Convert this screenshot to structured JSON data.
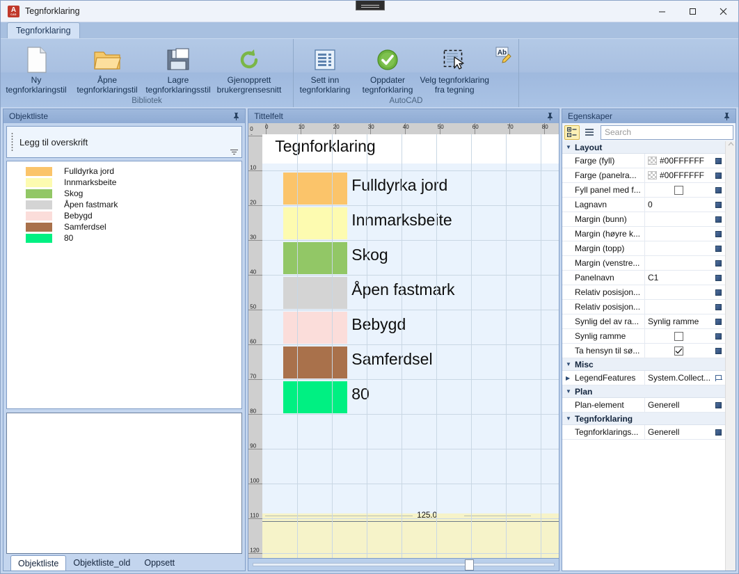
{
  "window": {
    "title": "Tegnforklaring",
    "logo_text": "A",
    "logo_sub": "CAD",
    "minimize": "minimize-icon",
    "maximize": "maximize-icon",
    "close": "close-icon"
  },
  "ribbon": {
    "tabs": [
      {
        "label": "Tegnforklaring",
        "active": true
      }
    ],
    "groups": [
      {
        "name": "Bibliotek",
        "buttons": [
          {
            "label": "Ny\ntegnforklaringstil",
            "icon": "new-document-icon"
          },
          {
            "label": "Åpne\ntegnforklaringstil",
            "icon": "open-folder-icon"
          },
          {
            "label": "Lagre\ntegnforklaringsstil",
            "icon": "save-floppy-icon"
          },
          {
            "label": "Gjenopprett\nbrukergrensesnitt",
            "icon": "restore-refresh-icon"
          }
        ]
      },
      {
        "name": "AutoCAD",
        "buttons": [
          {
            "label": "Sett inn\ntegnforklaring",
            "icon": "insert-legend-icon"
          },
          {
            "label": "Oppdater\ntegnforklaring",
            "icon": "green-check-icon"
          },
          {
            "label": "Velg tegnforklaring\nfra tegning",
            "icon": "select-from-drawing-icon"
          },
          {
            "label": "",
            "icon": "ab-edit-text-icon"
          }
        ]
      }
    ]
  },
  "left_panel": {
    "title": "Objektliste",
    "pin": "pin-icon",
    "header_dropzone": "Legg til overskrift",
    "items": [
      {
        "label": "Fulldyrka jord",
        "color": "#FBC46A"
      },
      {
        "label": "Innmarksbeite",
        "color": "#FDFBB0"
      },
      {
        "label": "Skog",
        "color": "#92C766"
      },
      {
        "label": "Åpen fastmark",
        "color": "#D4D4D4"
      },
      {
        "label": "Bebygd",
        "color": "#FBDDDA"
      },
      {
        "label": "Samferdsel",
        "color": "#A9714B"
      },
      {
        "label": "80",
        "color": "#00F082"
      }
    ],
    "tabs": [
      {
        "label": "Objektliste",
        "active": true
      },
      {
        "label": "Objektliste_old",
        "active": false
      },
      {
        "label": "Oppsett",
        "active": false
      }
    ]
  },
  "center_panel": {
    "title": "Tittelfelt",
    "pin": "pin-icon",
    "ruler": {
      "corner_label": "0",
      "h_ticks": [
        0,
        10,
        20,
        30,
        40,
        50,
        60,
        70,
        80
      ],
      "v_ticks": [
        0,
        10,
        20,
        30,
        40,
        50,
        60,
        70,
        80,
        90,
        100,
        110,
        120
      ]
    },
    "legend": {
      "title": "Tegnforklaring",
      "entries": [
        {
          "label": "Fulldyrka jord",
          "color": "#FBC46A"
        },
        {
          "label": "Innmarksbeite",
          "color": "#FDFBB0"
        },
        {
          "label": "Skog",
          "color": "#92C766"
        },
        {
          "label": "Åpen fastmark",
          "color": "#D4D4D4"
        },
        {
          "label": "Bebygd",
          "color": "#FBDDDA"
        },
        {
          "label": "Samferdsel",
          "color": "#A9714B"
        },
        {
          "label": "80",
          "color": "#00F082"
        }
      ]
    },
    "dimension_label": "125.0"
  },
  "right_panel": {
    "title": "Egenskaper",
    "pin": "pin-icon",
    "toolbar": {
      "categorized": "categorized-view-icon",
      "alphabetical": "alphabetical-view-icon",
      "search_placeholder": "Search",
      "search_value": ""
    },
    "categories": [
      {
        "name": "Layout",
        "expanded": true,
        "rows": [
          {
            "name": "Farge (fyll)",
            "value": "#00FFFFFF",
            "kind": "color"
          },
          {
            "name": "Farge (panelra...",
            "value": "#00FFFFFF",
            "kind": "color"
          },
          {
            "name": "Fyll panel med f...",
            "value": "",
            "kind": "checkbox",
            "checked": false
          },
          {
            "name": "Lagnavn",
            "value": "0",
            "kind": "text"
          },
          {
            "name": "Margin (bunn)",
            "value": "",
            "kind": "text"
          },
          {
            "name": "Margin (høyre k...",
            "value": "",
            "kind": "text"
          },
          {
            "name": "Margin (topp)",
            "value": "",
            "kind": "text"
          },
          {
            "name": "Margin (venstre...",
            "value": "",
            "kind": "text"
          },
          {
            "name": "Panelnavn",
            "value": "C1",
            "kind": "text"
          },
          {
            "name": "Relativ posisjon...",
            "value": "",
            "kind": "text"
          },
          {
            "name": "Relativ posisjon...",
            "value": "",
            "kind": "text"
          },
          {
            "name": "Synlig del av ra...",
            "value": "Synlig ramme",
            "kind": "text"
          },
          {
            "name": "Synlig ramme",
            "value": "",
            "kind": "checkbox",
            "checked": false
          },
          {
            "name": "Ta hensyn til sø...",
            "value": "",
            "kind": "checkbox",
            "checked": true
          }
        ]
      },
      {
        "name": "Misc",
        "expanded": true,
        "rows": [
          {
            "name": "LegendFeatures",
            "value": "System.Collect...",
            "kind": "expandable"
          }
        ]
      },
      {
        "name": "Plan",
        "expanded": true,
        "rows": [
          {
            "name": "Plan-element",
            "value": "Generell",
            "kind": "text"
          }
        ]
      },
      {
        "name": "Tegnforklaring",
        "expanded": true,
        "rows": [
          {
            "name": "Tegnforklarings...",
            "value": "Generell",
            "kind": "text"
          }
        ]
      }
    ]
  }
}
